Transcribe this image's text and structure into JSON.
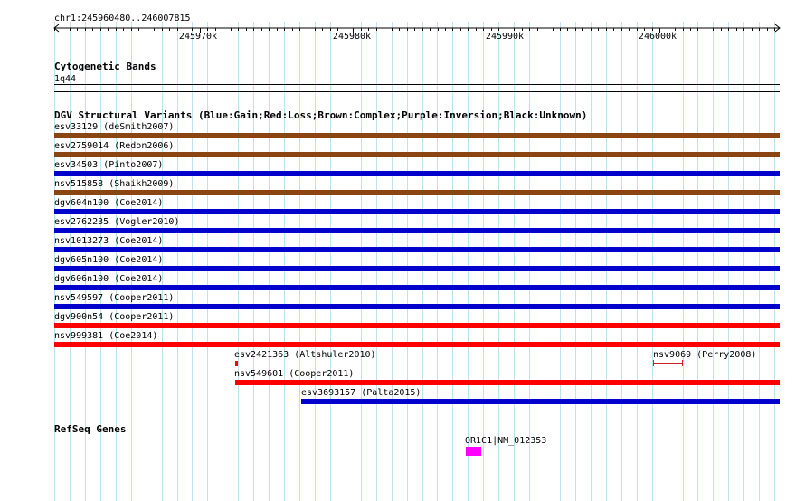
{
  "ruler": {
    "location": "chr1:245960480..246007815",
    "ticks": [
      "245970k",
      "245980k",
      "245990k",
      "246000k"
    ]
  },
  "cytoband": {
    "title": "Cytogenetic Bands",
    "band": "1q44"
  },
  "dgv": {
    "title": "DGV Structural Variants (Blue:Gain;Red:Loss;Brown:Complex;Purple:Inversion;Black:Unknown)",
    "colors": {
      "gain": "#0000cc",
      "loss": "#ff0000",
      "complex": "#8b4513",
      "unknown": "#cc2222"
    },
    "features": [
      {
        "label": "esv33129 (deSmith2007)",
        "type": "complex"
      },
      {
        "label": "esv2759014 (Redon2006)",
        "type": "complex"
      },
      {
        "label": "esv34503 (Pinto2007)",
        "type": "gain"
      },
      {
        "label": "nsv515858 (Shaikh2009)",
        "type": "complex"
      },
      {
        "label": "dgv604n100 (Coe2014)",
        "type": "gain"
      },
      {
        "label": "esv2762235 (Vogler2010)",
        "type": "gain"
      },
      {
        "label": "nsv1013273 (Coe2014)",
        "type": "gain"
      },
      {
        "label": "dgv605n100 (Coe2014)",
        "type": "gain"
      },
      {
        "label": "dgv606n100 (Coe2014)",
        "type": "gain"
      },
      {
        "label": "nsv549597 (Cooper2011)",
        "type": "gain"
      },
      {
        "label": "dgv900n54 (Cooper2011)",
        "type": "loss"
      },
      {
        "label": "nsv999381 (Coe2014)",
        "type": "loss"
      },
      {
        "label": "esv2421363 (Altshuler2010)",
        "type": "loss"
      },
      {
        "label": "nsv9069 (Perry2008)",
        "type": "unknown"
      },
      {
        "label": "nsv549601 (Cooper2011)",
        "type": "loss"
      },
      {
        "label": "esv3693157 (Palta2015)",
        "type": "gain"
      }
    ]
  },
  "refseq": {
    "title": "RefSeq Genes",
    "gene_label": "OR1C1|NM_012353",
    "gene_color": "#ff00ff"
  }
}
